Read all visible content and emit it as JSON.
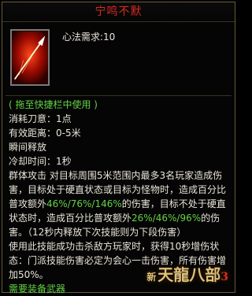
{
  "title": "宁鸣不默",
  "icon": {
    "name": "spear-skill-icon"
  },
  "requirement": "心法需求:10",
  "usage_hint": "( 拖至快捷栏中使用 )",
  "stats": [
    "消耗刀意：1点",
    "有效距离：0-5米",
    "瞬间释放",
    "冷却时间：1秒"
  ],
  "desc": {
    "p1a": "群体攻击 对目标周围5米范围内最多3名玩家造成伤害，目标处于硬直状态或目标为怪物时，造成百分比普攻额外",
    "p1b": "46%/76%/146%",
    "p1c": "的伤害，目标不处于硬直状态时，造成百分比普攻额外",
    "p1d": "26%/46%/96%",
    "p1e": "的伤害。",
    "p2": "（12秒内释放下次技能则为下段伤害）",
    "p3": "使用此技能成功击杀敌方玩家时，获得10秒增伤状态：门派技能伤害必定为会心一击伤害，所有伤害增加50%。"
  },
  "weapon_req": "需要装备武器",
  "logo": {
    "prefix": "新",
    "main": "天龍八部",
    "suffix": "3"
  }
}
